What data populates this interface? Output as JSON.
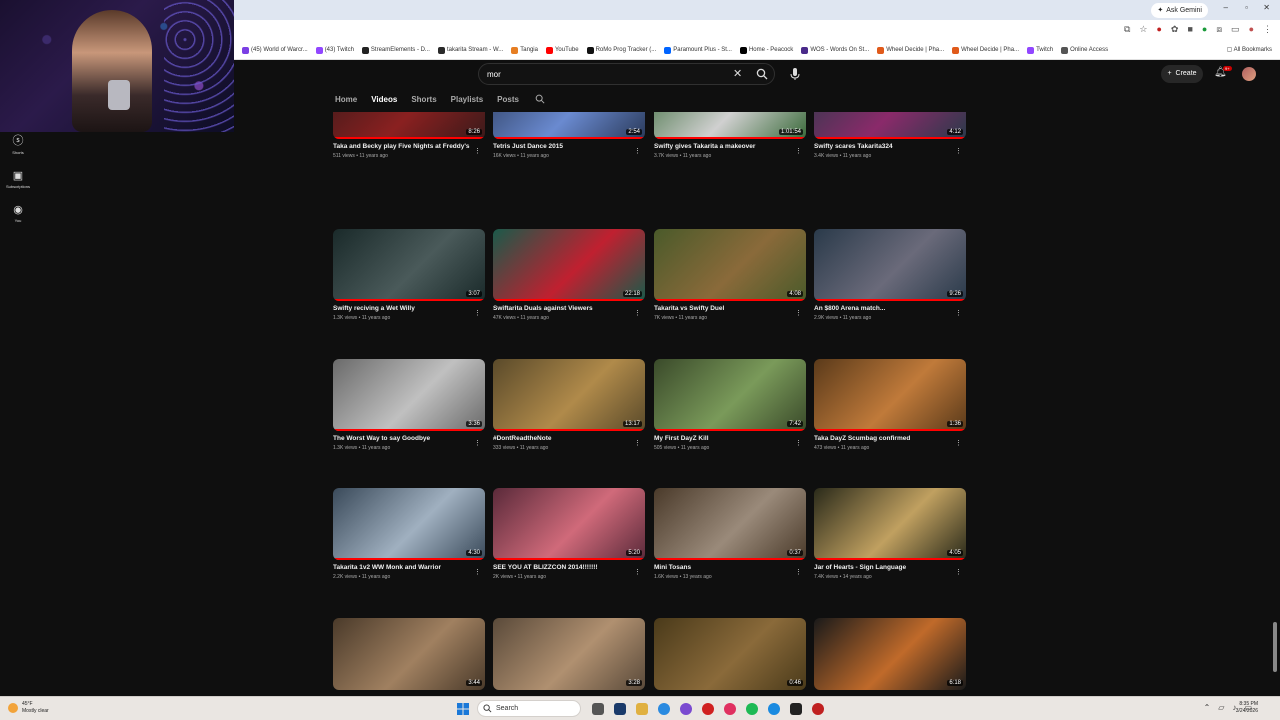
{
  "browser": {
    "ask_gemini": "Ask Gemini",
    "bookmarks": [
      {
        "label": "(45) World of Warcr...",
        "color": "#7b3fe4"
      },
      {
        "label": "(43) Twitch",
        "color": "#9146ff"
      },
      {
        "label": "StreamElements - D...",
        "color": "#222222"
      },
      {
        "label": "takarita Stream - W...",
        "color": "#2a2a2a"
      },
      {
        "label": "Tangia",
        "color": "#e67e22"
      },
      {
        "label": "YouTube",
        "color": "#ff0000"
      },
      {
        "label": "RoMo Prog Tracker (...",
        "color": "#111111"
      },
      {
        "label": "Paramount Plus - St...",
        "color": "#0064ff"
      },
      {
        "label": "Home - Peacock",
        "color": "#000000"
      },
      {
        "label": "WOS - Words On St...",
        "color": "#4a2a8a"
      },
      {
        "label": "Wheel Decide | Pha...",
        "color": "#e05a1a"
      },
      {
        "label": "Wheel Decide | Pha...",
        "color": "#e05a1a"
      },
      {
        "label": "Twitch",
        "color": "#9146ff"
      },
      {
        "label": "Online Access",
        "color": "#555555"
      }
    ],
    "all_bookmarks": "All Bookmarks"
  },
  "sidebar": {
    "items": [
      {
        "label": "Shorts"
      },
      {
        "label": "Subscriptions"
      },
      {
        "label": "You"
      }
    ]
  },
  "header": {
    "search_value": "mor",
    "create_label": "Create",
    "notif_badge": "9+"
  },
  "tabs": [
    {
      "label": "Home"
    },
    {
      "label": "Videos"
    },
    {
      "label": "Shorts"
    },
    {
      "label": "Playlists"
    },
    {
      "label": "Posts"
    }
  ],
  "videos": [
    {
      "title": "Taka and Becky play Five Nights at Freddy's",
      "meta": "511 views • 11 years ago",
      "duration": "8:26",
      "colors": [
        "#3a1a1a",
        "#8a2020"
      ]
    },
    {
      "title": "Tetris Just Dance 2015",
      "meta": "16K views • 11 years ago",
      "duration": "2:54",
      "colors": [
        "#2a3a5a",
        "#6a8ad0"
      ]
    },
    {
      "title": "Swifty gives Takarita a makeover",
      "meta": "3.7K views • 11 years ago",
      "duration": "1:01:54",
      "colors": [
        "#3a6a3a",
        "#d0d0d0"
      ]
    },
    {
      "title": "Swifty scares Takarita324",
      "meta": "3.4K views • 11 years ago",
      "duration": "4:12",
      "colors": [
        "#2a3a4a",
        "#8a2a6a"
      ]
    },
    {
      "title": "Swifty reciving a Wet Willy",
      "meta": "1.3K views • 11 years ago",
      "duration": "3:07",
      "colors": [
        "#1a2a2a",
        "#4a5a5a"
      ]
    },
    {
      "title": "Swiftarita Duals against Viewers",
      "meta": "47K views • 11 years ago",
      "duration": "22:18",
      "colors": [
        "#1a5a4a",
        "#c02030"
      ]
    },
    {
      "title": "Takarita vs Swifty Duel",
      "meta": "7K views • 11 years ago",
      "duration": "4:08",
      "colors": [
        "#4a5a2a",
        "#8a6a3a"
      ]
    },
    {
      "title": "An $800 Arena match...",
      "meta": "2.9K views • 11 years ago",
      "duration": "9:26",
      "colors": [
        "#2a3a4a",
        "#6a6a7a"
      ]
    },
    {
      "title": "The Worst Way to say Goodbye",
      "meta": "1.3K views • 11 years ago",
      "duration": "3:36",
      "colors": [
        "#6a6a6a",
        "#c0c0c0"
      ]
    },
    {
      "title": "#DontReadtheNote",
      "meta": "333 views • 11 years ago",
      "duration": "13:17",
      "colors": [
        "#5a4a2a",
        "#b08a4a"
      ]
    },
    {
      "title": "My First DayZ Kill",
      "meta": "505 views • 11 years ago",
      "duration": "7:42",
      "colors": [
        "#3a4a2a",
        "#7a9a5a"
      ]
    },
    {
      "title": "Taka DayZ Scumbag confirmed",
      "meta": "473 views • 11 years ago",
      "duration": "1:36",
      "colors": [
        "#5a3a1a",
        "#c07a3a"
      ]
    },
    {
      "title": "Takarita 1v2 WW Monk and Warrior",
      "meta": "2.2K views • 11 years ago",
      "duration": "4:30",
      "colors": [
        "#3a4a5a",
        "#a0b0c0"
      ]
    },
    {
      "title": "SEE YOU AT BLIZZCON 2014!!!!!!!",
      "meta": "2K views • 11 years ago",
      "duration": "5:20",
      "colors": [
        "#5a2a3a",
        "#d06a7a"
      ]
    },
    {
      "title": "Mini Tosans",
      "meta": "1.6K views • 13 years ago",
      "duration": "0:37",
      "colors": [
        "#4a3a2a",
        "#9a8a7a"
      ]
    },
    {
      "title": "Jar of Hearts - Sign Language",
      "meta": "7.4K views • 14 years ago",
      "duration": "4:05",
      "colors": [
        "#2a2a1a",
        "#c0a060"
      ]
    },
    {
      "title": "",
      "meta": "",
      "duration": "3:44",
      "colors": [
        "#4a3a2a",
        "#a08060"
      ]
    },
    {
      "title": "",
      "meta": "",
      "duration": "3:28",
      "colors": [
        "#5a4a3a",
        "#b09070"
      ]
    },
    {
      "title": "",
      "meta": "",
      "duration": "0:46",
      "colors": [
        "#4a3a1a",
        "#8a6a3a"
      ]
    },
    {
      "title": "",
      "meta": "",
      "duration": "6:18",
      "colors": [
        "#1a1a1a",
        "#c06a2a"
      ]
    }
  ],
  "taskbar": {
    "weather_temp": "45°F",
    "weather_desc": "Mostly clear",
    "search_label": "Search",
    "time": "8:35 PM",
    "date": "3/24/2026"
  }
}
